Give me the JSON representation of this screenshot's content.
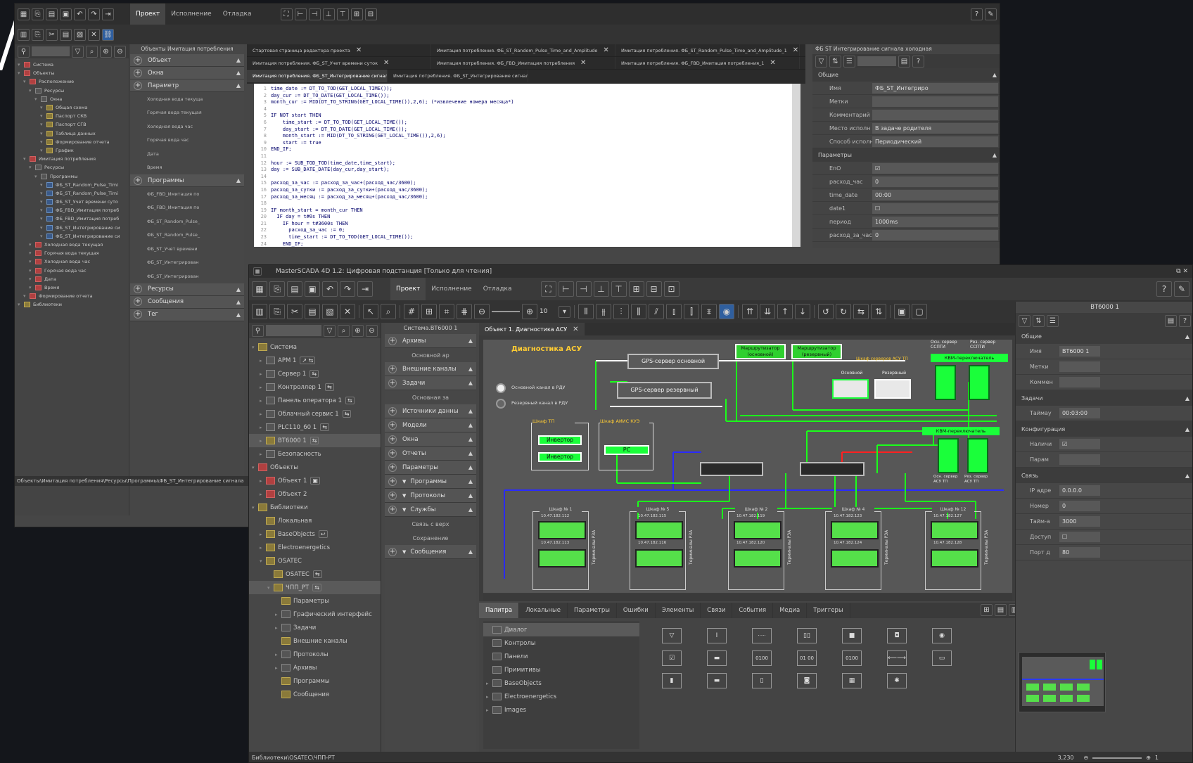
{
  "back_window": {
    "menu_tabs": [
      "Проект",
      "Исполнение",
      "Отладка"
    ],
    "tree": [
      {
        "label": "Система",
        "indent": 0,
        "icon": "red"
      },
      {
        "label": "Объекты",
        "indent": 0,
        "icon": "red"
      },
      {
        "label": "Расположение",
        "indent": 1,
        "icon": "red"
      },
      {
        "label": "Ресурсы",
        "indent": 2,
        "icon": "gray"
      },
      {
        "label": "Окна",
        "indent": 3,
        "icon": "gray"
      },
      {
        "label": "Общая схема",
        "indent": 4,
        "icon": "olive"
      },
      {
        "label": "Паспорт СКВ",
        "indent": 4,
        "icon": "olive"
      },
      {
        "label": "Паспорт СГВ",
        "indent": 4,
        "icon": "olive"
      },
      {
        "label": "Таблица данных",
        "indent": 4,
        "icon": "olive"
      },
      {
        "label": "Формирование отчета",
        "indent": 4,
        "icon": "olive"
      },
      {
        "label": "График",
        "indent": 4,
        "icon": "olive"
      },
      {
        "label": "Имитация потребления",
        "indent": 1,
        "icon": "red"
      },
      {
        "label": "Ресурсы",
        "indent": 2,
        "icon": "gray"
      },
      {
        "label": "Программы",
        "indent": 3,
        "icon": "gray"
      },
      {
        "label": "ФБ_ST_Random_Pulse_Timi",
        "indent": 4,
        "icon": "blue"
      },
      {
        "label": "ФБ_ST_Random_Pulse_Timi",
        "indent": 4,
        "icon": "blue"
      },
      {
        "label": "ФБ_ST_Учет времени суто",
        "indent": 4,
        "icon": "blue"
      },
      {
        "label": "ФБ_FBD_Имитация потреб",
        "indent": 4,
        "icon": "blue"
      },
      {
        "label": "ФБ_FBD_Имитация потреб",
        "indent": 4,
        "icon": "blue"
      },
      {
        "label": "ФБ_ST_Интегрирование си",
        "indent": 4,
        "icon": "blue"
      },
      {
        "label": "ФБ_ST_Интегрирование си",
        "indent": 4,
        "icon": "blue"
      },
      {
        "label": "Холодная вода текущая",
        "indent": 2,
        "icon": "red"
      },
      {
        "label": "Горячая вода текущая",
        "indent": 2,
        "icon": "red"
      },
      {
        "label": "Холодная вода час",
        "indent": 2,
        "icon": "red"
      },
      {
        "label": "Горячая вода час",
        "indent": 2,
        "icon": "red"
      },
      {
        "label": "Дата",
        "indent": 2,
        "icon": "red"
      },
      {
        "label": "Время",
        "indent": 2,
        "icon": "red"
      },
      {
        "label": "Формирование отчета",
        "indent": 1,
        "icon": "red"
      },
      {
        "label": "Библиотеки",
        "indent": 0,
        "icon": "olive"
      }
    ],
    "status_path": "Объекты\\Имитация потребления\\Ресурсы\\Программы\\ФБ_ST_Интегрирование сигнала",
    "objects_panel_title": "Объекты Имитация потребления",
    "objects_sections": [
      {
        "label": "Объект",
        "items": []
      },
      {
        "label": "Окна",
        "items": []
      },
      {
        "label": "Параметр",
        "items": [
          "Холодная вода текуща",
          "Горячая вода текущая",
          "Холодная вода час",
          "Горячая вода час",
          "Дата",
          "Время"
        ]
      },
      {
        "label": "Программы",
        "items": [
          "ФБ_FBD_Имитация по",
          "ФБ_FBD_Имитация по",
          "ФБ_ST_Random_Pulse_",
          "ФБ_ST_Random_Pulse_",
          "ФБ_ST_Учет времени",
          "ФБ_ST_Интегрирован",
          "ФБ_ST_Интегрирован"
        ]
      },
      {
        "label": "Ресурсы",
        "items": []
      },
      {
        "label": "Сообщения",
        "items": []
      },
      {
        "label": "Тег",
        "items": []
      }
    ],
    "editor_tabs_row1": [
      "Стартовая страница редактора проекта",
      "Имитация потребления. ФБ_ST_Random_Pulse_Time_and_Amplitude",
      "Имитация потребления. ФБ_ST_Random_Pulse_Time_and_Amplitude_1"
    ],
    "editor_tabs_row2": [
      "Имитация потребления. ФБ_ST_Учет времени суток",
      "Имитация потребления. ФБ_FBD_Имитация потребления",
      "Имитация потребления. ФБ_FBD_Имитация потребления_1"
    ],
    "editor_tabs_row3": [
      "Имитация потребления. ФБ_ST_Интегрирование сигнала_холодная",
      "Имитация потребления. ФБ_ST_Интегрирование сигнала_горячая"
    ],
    "code_lines": [
      "time_date := DT_TO_TOD(GET_LOCAL_TIME());",
      "day_cur := DT_TO_DATE(GET_LOCAL_TIME());",
      "month_cur := MID(DT_TO_STRING(GET_LOCAL_TIME()),2,6); (*извлечение номера месяца*)",
      "",
      "IF NOT start THEN",
      "    time_start := DT_TO_TOD(GET_LOCAL_TIME());",
      "    day_start := DT_TO_DATE(GET_LOCAL_TIME());",
      "    month_start := MID(DT_TO_STRING(GET_LOCAL_TIME()),2,6);",
      "    start := true",
      "END_IF;",
      "",
      "hour := SUB_TOD_TOD(time_date,time_start);",
      "day := SUB_DATE_DATE(day_cur,day_start);",
      "",
      "расход_за_час := расход_за_час+(расход_час/3600);",
      "расход_за_сутки := расход_за_сутки+(расход_час/3600);",
      "расход_за_месяц := расход_за_месяц+(расход_час/3600);",
      "",
      "IF month_start = month_cur THEN",
      "  IF day = t#0s THEN",
      "    IF hour = t#3600s THEN",
      "      расход_за_час := 0;",
      "      time_start := DT_TO_TOD(GET_LOCAL_TIME());",
      "    END_IF;"
    ],
    "props_title": "ФБ ST Интегрирование сигнала холодная",
    "props_general_label": "Общие",
    "props_general": [
      {
        "k": "Имя",
        "v": "ФБ_ST_Интегриро"
      },
      {
        "k": "Метки",
        "v": ""
      },
      {
        "k": "Комментарий",
        "v": ""
      },
      {
        "k": "Место исполн",
        "v": "В задаче родителя"
      },
      {
        "k": "Способ исполн",
        "v": "Периодический"
      }
    ],
    "props_params_label": "Параметры",
    "props_params": [
      {
        "k": "EnO",
        "v": "☑"
      },
      {
        "k": "расход_час",
        "v": "0"
      },
      {
        "k": "time_date",
        "v": "00:00"
      },
      {
        "k": "date1",
        "v": "☐"
      },
      {
        "k": "период",
        "v": "1000ms"
      },
      {
        "k": "расход_за_час",
        "v": "0"
      }
    ]
  },
  "front_window": {
    "title": "MasterSCADA 4D 1.2: Цифровая подстанция [Только для чтения]",
    "menu_tabs": [
      "Проект",
      "Исполнение",
      "Отладка"
    ],
    "zoom_value": "10",
    "tree": [
      {
        "label": "Система",
        "indent": 0,
        "icon": "olive",
        "arrow": "▾",
        "tag": ""
      },
      {
        "label": "АРМ 1",
        "indent": 1,
        "icon": "gray",
        "arrow": "▸",
        "tag": "↗ ⇆"
      },
      {
        "label": "Сервер 1",
        "indent": 1,
        "icon": "gray",
        "arrow": "▸",
        "tag": "⇆"
      },
      {
        "label": "Контроллер 1",
        "indent": 1,
        "icon": "gray",
        "arrow": "▸",
        "tag": "⇆"
      },
      {
        "label": "Панель оператора 1",
        "indent": 1,
        "icon": "gray",
        "arrow": "▸",
        "tag": "⇆"
      },
      {
        "label": "Облачный сервис 1",
        "indent": 1,
        "icon": "gray",
        "arrow": "▸",
        "tag": "⇆"
      },
      {
        "label": "PLC110_60 1",
        "indent": 1,
        "icon": "gray",
        "arrow": "▸",
        "tag": "⇆"
      },
      {
        "label": "BT6000 1",
        "indent": 1,
        "icon": "olive",
        "arrow": "▸",
        "tag": "⇆",
        "selected": true
      },
      {
        "label": "Безопасность",
        "indent": 1,
        "icon": "gray",
        "arrow": "▸",
        "tag": ""
      },
      {
        "label": "Объекты",
        "indent": 0,
        "icon": "red",
        "arrow": "▾",
        "tag": ""
      },
      {
        "label": "Объект 1",
        "indent": 1,
        "icon": "red",
        "arrow": "▸",
        "tag": "▣"
      },
      {
        "label": "Объект 2",
        "indent": 1,
        "icon": "red",
        "arrow": "▸",
        "tag": ""
      },
      {
        "label": "Библиотеки",
        "indent": 0,
        "icon": "olive",
        "arrow": "▾",
        "tag": ""
      },
      {
        "label": "Локальная",
        "indent": 1,
        "icon": "olive",
        "arrow": "",
        "tag": ""
      },
      {
        "label": "BaseObjects",
        "indent": 1,
        "icon": "olive",
        "arrow": "▸",
        "tag": "↩"
      },
      {
        "label": "Electroenergetics",
        "indent": 1,
        "icon": "olive",
        "arrow": "▸",
        "tag": ""
      },
      {
        "label": "OSATEC",
        "indent": 1,
        "icon": "olive",
        "arrow": "▾",
        "tag": ""
      },
      {
        "label": "OSATEC",
        "indent": 2,
        "icon": "olive",
        "arrow": "",
        "tag": "⇆"
      },
      {
        "label": "ЧПП_РТ",
        "indent": 2,
        "icon": "olive",
        "arrow": "▾",
        "tag": "⇆",
        "selected": true
      },
      {
        "label": "Параметры",
        "indent": 3,
        "icon": "olive",
        "arrow": "",
        "tag": ""
      },
      {
        "label": "Графический интерфейс",
        "indent": 3,
        "icon": "gray",
        "arrow": "▸",
        "tag": ""
      },
      {
        "label": "Задачи",
        "indent": 3,
        "icon": "gray",
        "arrow": "▸",
        "tag": ""
      },
      {
        "label": "Внешние каналы",
        "indent": 3,
        "icon": "olive",
        "arrow": "",
        "tag": ""
      },
      {
        "label": "Протоколы",
        "indent": 3,
        "icon": "gray",
        "arrow": "▸",
        "tag": ""
      },
      {
        "label": "Архивы",
        "indent": 3,
        "icon": "gray",
        "arrow": "▸",
        "tag": ""
      },
      {
        "label": "Программы",
        "indent": 3,
        "icon": "olive",
        "arrow": "",
        "tag": ""
      },
      {
        "label": "Сообщения",
        "indent": 3,
        "icon": "olive",
        "arrow": "",
        "tag": ""
      }
    ],
    "status_path": "Библиотеки\\OSATEC\\ЧПП-РТ",
    "status_zoom": "3,230",
    "status_zoom_out": "⊖",
    "status_zoom_in": "⊕",
    "status_page": "1",
    "system_panel_title": "Система.BT6000 1",
    "system_sections": [
      {
        "label": "Архивы",
        "item": "Основной ар",
        "filter": false
      },
      {
        "label": "Внешние каналы",
        "item": "",
        "filter": false
      },
      {
        "label": "Задачи",
        "item": "Основная за",
        "filter": false
      },
      {
        "label": "Источники данны",
        "item": "",
        "filter": false
      },
      {
        "label": "Модели",
        "item": "",
        "filter": false
      },
      {
        "label": "Окна",
        "item": "",
        "filter": false
      },
      {
        "label": "Отчеты",
        "item": "",
        "filter": false
      },
      {
        "label": "Параметры",
        "item": "",
        "filter": false
      },
      {
        "label": "Программы",
        "item": "",
        "filter": true
      },
      {
        "label": "Протоколы",
        "item": "",
        "filter": true
      },
      {
        "label": "Службы",
        "item": "Связь с верх|Сохранение",
        "filter": true
      },
      {
        "label": "Сообщения",
        "item": "",
        "filter": true
      }
    ],
    "doc_tab": "Объект 1. Диагностика АСУ",
    "diagram": {
      "title": "Диагностика АСУ",
      "legend_main": "Основной канал в РДУ",
      "legend_reserve": "Резервный канал в РДУ",
      "gps_main": "GPS-сервер основной",
      "gps_reserve": "GPS-сервер резервный",
      "router_main": "Маршрутизатор (основной)",
      "router_reserve": "Маршрутизатор (резервный)",
      "servers_label": "Осн. сервер ССПТИ",
      "servers_label2": "Рез. сервер ССПТИ",
      "kvm1": "КВМ-переключатель",
      "kvm2": "КВМ-переключатель",
      "cab_asu": "Шкаф серверов АСУ ТП",
      "main_lbl": "Основной",
      "reserve_lbl": "Резервный",
      "cab_tp": "Шкаф ТП",
      "inverter1": "Инвертор",
      "inverter2": "Инвертор",
      "cab_aiis": "Шкаф АИИС КУЭ",
      "pc": "PC",
      "srv_asu1": "Осн. сервер АСУ ТП",
      "srv_asu2": "Рез. сервер АСУ ТП",
      "rza_label": "Терминалы РЗА",
      "cabinets": [
        {
          "name": "Шкаф №    1",
          "ip1": "10.47.182.112",
          "ip2": "10.47.182.113"
        },
        {
          "name": "Шкаф №    5",
          "ip1": "10.47.182.115",
          "ip2": "10.47.182.116"
        },
        {
          "name": "Шкаф №    2",
          "ip1": "10.47.182.119",
          "ip2": "10.47.182.120"
        },
        {
          "name": "Шкаф №    4",
          "ip1": "10.47.182.123",
          "ip2": "10.47.182.124"
        },
        {
          "name": "Шкаф №    12",
          "ip1": "10.47.182.127",
          "ip2": "10.47.182.128"
        }
      ]
    },
    "bottom_tabs": [
      "Палитра",
      "Локальные",
      "Параметры",
      "Ошибки",
      "Элементы",
      "Связи",
      "События",
      "Медиа",
      "Триггеры"
    ],
    "palette_tree": [
      "Диалог",
      "Контролы",
      "Панели",
      "Примитивы",
      "BaseObjects",
      "Electroenergetics",
      "Images"
    ],
    "palette_items": [
      "▽",
      "I",
      "·····",
      "▯▯",
      "■",
      "◘",
      "◉",
      "☑",
      "▬",
      "0100",
      "01 00",
      "0100",
      "⟵⟶",
      "▭",
      "▮",
      "▬",
      "▯",
      "◙",
      "▦",
      "✱"
    ],
    "props_title": "BT6000 1",
    "props_general_label": "Общие",
    "props_general": [
      {
        "k": "Имя",
        "v": "BT6000 1"
      },
      {
        "k": "Метки",
        "v": ""
      },
      {
        "k": "Коммен",
        "v": ""
      }
    ],
    "props_tasks_label": "Задачи",
    "props_tasks": [
      {
        "k": "Таймау",
        "v": "00:03:00"
      }
    ],
    "props_config_label": "Конфигурация",
    "props_config": [
      {
        "k": "Наличи",
        "v": "☑"
      },
      {
        "k": "Парам",
        "v": ""
      }
    ],
    "props_link_label": "Связь",
    "props_link": [
      {
        "k": "IP адре",
        "v": "0.0.0.0"
      },
      {
        "k": "Номер",
        "v": "0"
      },
      {
        "k": "Тайм-а",
        "v": "3000"
      },
      {
        "k": "Доступ",
        "v": "☐"
      },
      {
        "k": "Порт д",
        "v": "80"
      }
    ]
  }
}
